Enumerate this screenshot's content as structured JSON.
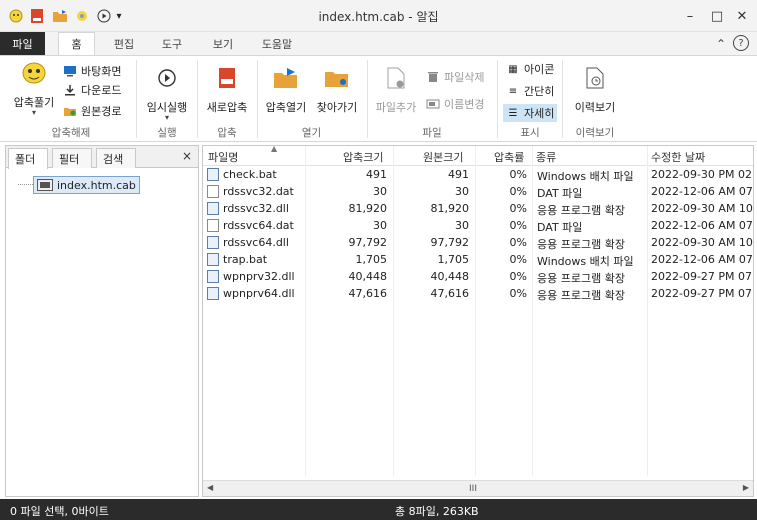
{
  "window": {
    "title": "index.htm.cab - 알집",
    "controls": {
      "minimize": "–",
      "maximize": "□",
      "close": "✕"
    }
  },
  "menu": {
    "tabs": [
      "파일",
      "홈",
      "편집",
      "도구",
      "보기",
      "도움말"
    ],
    "active_tab": "홈",
    "right_icons": {
      "collapse": "⌃",
      "help": "?"
    }
  },
  "ribbon": {
    "extract": {
      "main_label": "압축풀기",
      "desktop_label": "바탕화면",
      "downloads_label": "다운로드",
      "original_path_label": "원본경로",
      "group_label": "압축해제"
    },
    "run": {
      "temp_run_label": "임시실행",
      "group_label": "실행"
    },
    "compress": {
      "new_compress_label": "새로압축",
      "group_label": "압축"
    },
    "open": {
      "open_archive_label": "압축열기",
      "find_label": "찾아가기",
      "group_label": "열기"
    },
    "file": {
      "add_file_label": "파일추가",
      "delete_file_label": "파일삭제",
      "rename_label": "이름변경",
      "group_label": "파일"
    },
    "view": {
      "icon_label": "아이콘",
      "simple_label": "간단히",
      "detail_label": "자세히",
      "group_label": "표시"
    },
    "history": {
      "history_label": "이력보기",
      "group_label": "이력보기"
    }
  },
  "left_panel": {
    "tabs": [
      "폴더",
      "필터",
      "검색"
    ],
    "active_tab": "폴더",
    "close": "×",
    "tree": {
      "root_label": "index.htm.cab"
    }
  },
  "file_list": {
    "columns": [
      "파일명",
      "압축크기",
      "원본크기",
      "압축률",
      "종류",
      "수정한 날짜"
    ],
    "rows": [
      {
        "name": "check.bat",
        "packed": "491",
        "size": "491",
        "ratio": "0%",
        "type": "Windows 배치 파일",
        "date": "2022-09-30 PM 02:",
        "icon": "app"
      },
      {
        "name": "rdssvc32.dat",
        "packed": "30",
        "size": "30",
        "ratio": "0%",
        "type": "DAT 파일",
        "date": "2022-12-06 AM 07",
        "icon": "doc"
      },
      {
        "name": "rdssvc32.dll",
        "packed": "81,920",
        "size": "81,920",
        "ratio": "0%",
        "type": "응용 프로그램 확장",
        "date": "2022-09-30 AM 10",
        "icon": "app"
      },
      {
        "name": "rdssvc64.dat",
        "packed": "30",
        "size": "30",
        "ratio": "0%",
        "type": "DAT 파일",
        "date": "2022-12-06 AM 07",
        "icon": "doc"
      },
      {
        "name": "rdssvc64.dll",
        "packed": "97,792",
        "size": "97,792",
        "ratio": "0%",
        "type": "응용 프로그램 확장",
        "date": "2022-09-30 AM 10",
        "icon": "app"
      },
      {
        "name": "trap.bat",
        "packed": "1,705",
        "size": "1,705",
        "ratio": "0%",
        "type": "Windows 배치 파일",
        "date": "2022-12-06 AM 07",
        "icon": "app"
      },
      {
        "name": "wpnprv32.dll",
        "packed": "40,448",
        "size": "40,448",
        "ratio": "0%",
        "type": "응용 프로그램 확장",
        "date": "2022-09-27 PM 07:",
        "icon": "app"
      },
      {
        "name": "wpnprv64.dll",
        "packed": "47,616",
        "size": "47,616",
        "ratio": "0%",
        "type": "응용 프로그램 확장",
        "date": "2022-09-27 PM 07:",
        "icon": "app"
      }
    ],
    "scroll_thumb": "III"
  },
  "status": {
    "selection": "0 파일 선택, 0바이트",
    "total": "총 8파일, 263KB"
  },
  "colors": {
    "dark_bar": "#2b2b2b",
    "selection_blue": "#cde4f7",
    "accent_blue": "#1e6fc7",
    "folder_orange": "#e8a23a",
    "zip_red": "#d9472b"
  }
}
